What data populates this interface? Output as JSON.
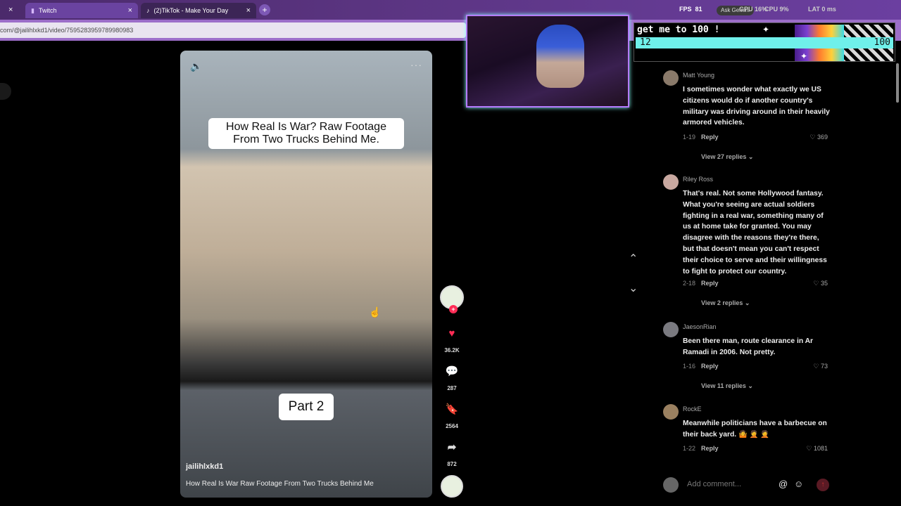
{
  "browser": {
    "tabs": [
      {
        "label": "Twitch",
        "close": "×"
      },
      {
        "label": "(2)TikTok - Make Your Day",
        "close": "×"
      }
    ],
    "close_first": "×",
    "new_tab": "+",
    "url": "com/@jailihlxkd1/video/7595283959789980983"
  },
  "overlay": {
    "fps_label": "FPS",
    "fps": "81",
    "gpu_label": "GPU",
    "gpu": "16%",
    "cpu_label": "CPU",
    "cpu": "9%",
    "lat_label": "LAT",
    "lat": "0 ms",
    "gemini": "Ask Gemini",
    "goal_title": "get me to 100 !",
    "goal_current": "12",
    "goal_max": "100"
  },
  "video": {
    "caption": "How Real Is War? Raw Footage From Two Trucks Behind Me.",
    "part": "Part 2",
    "author": "jailihlxkd1",
    "description": "How Real Is War Raw Footage From Two Trucks Behind Me"
  },
  "actions": {
    "likes": "36.2K",
    "comments": "287",
    "saves": "2564",
    "shares": "872"
  },
  "comments": [
    {
      "name": "Matt Young",
      "text": "I sometimes wonder what exactly we US citizens would do if another country's military was driving around in their heavily armored vehicles.",
      "date": "1-19",
      "reply": "Reply",
      "likes": "369",
      "view": "View 27 replies"
    },
    {
      "name": "Riley Ross",
      "text": "That's real. Not some Hollywood fantasy. What you're seeing are actual soldiers fighting in a real war, something many of us at home take for granted. You may disagree with the reasons they're there, but that doesn't mean you can't respect their choice to serve and their willingness to fight to protect our country.",
      "date": "2-18",
      "reply": "Reply",
      "likes": "35",
      "view": "View 2 replies"
    },
    {
      "name": "JaesonRian",
      "text": "Been there man, route clearance in Ar Ramadi in 2006. Not pretty.",
      "date": "1-16",
      "reply": "Reply",
      "likes": "73",
      "view": "View 11 replies"
    },
    {
      "name": "RockE",
      "text": "Meanwhile politicians have a barbecue on their back yard. 🤷 🤦 🤦",
      "date": "1-22",
      "reply": "Reply",
      "likes": "1081",
      "view": ""
    }
  ],
  "add_comment": {
    "placeholder": "Add comment..."
  },
  "colors": {
    "accent_like": "#fe2c55",
    "goal_bar": "#6ff0ea",
    "tab_bar": "#5a3480"
  }
}
